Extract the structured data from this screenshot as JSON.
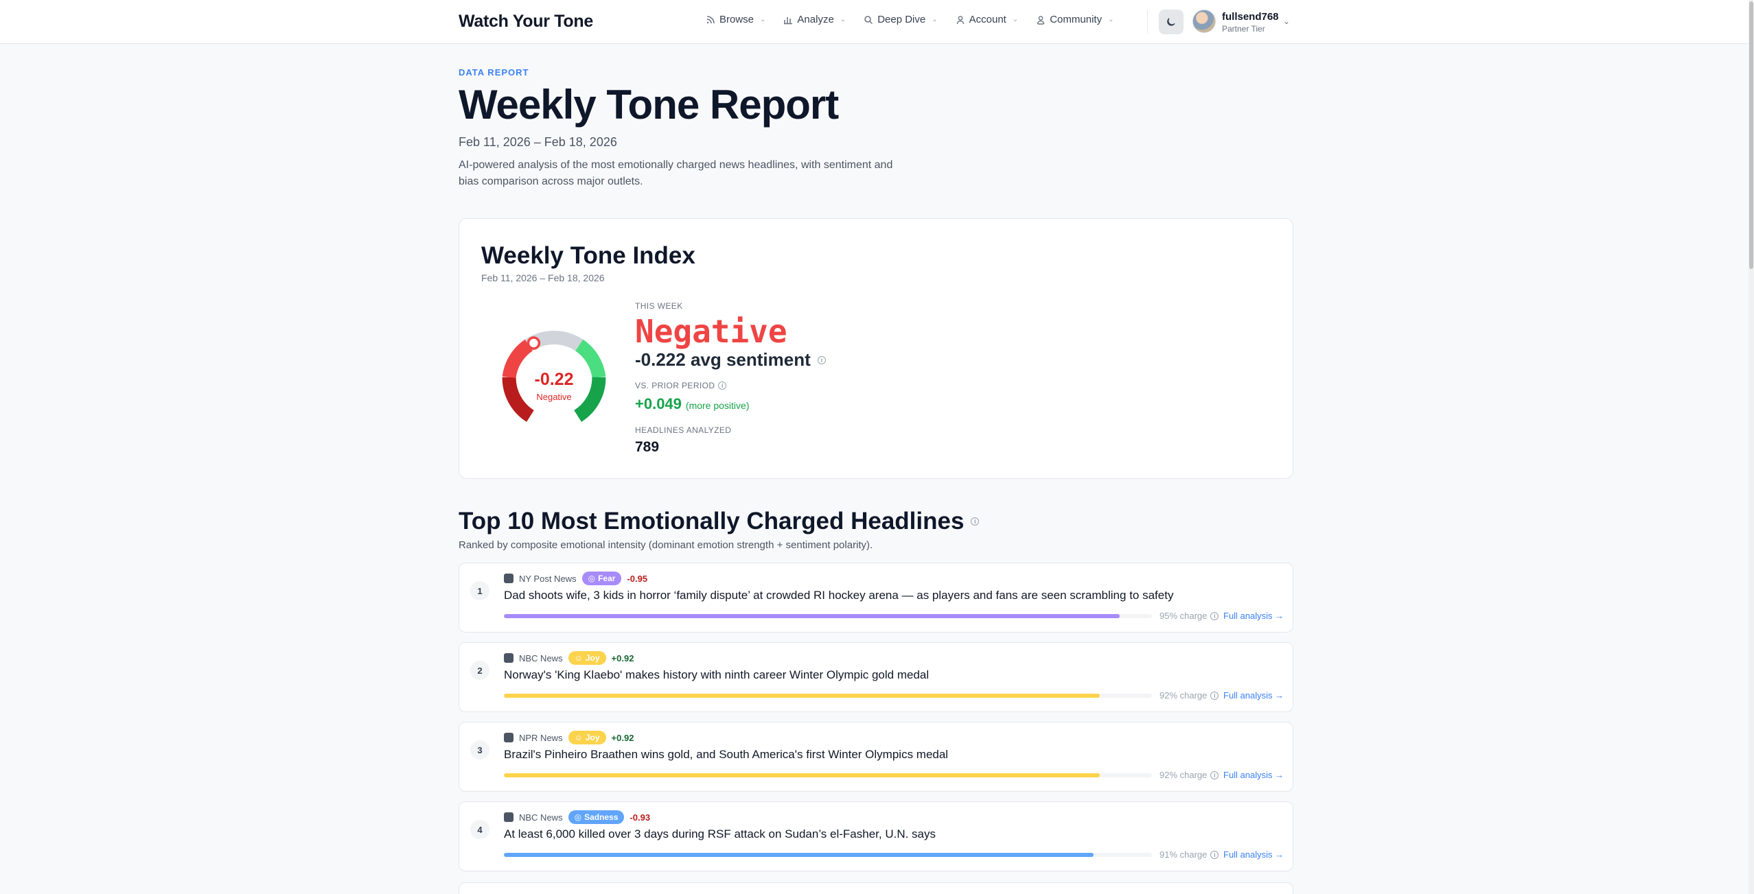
{
  "nav": {
    "brand": "Watch Your Tone",
    "menu": [
      {
        "label": "Browse",
        "icon": "rss-icon"
      },
      {
        "label": "Analyze",
        "icon": "bar-chart-icon"
      },
      {
        "label": "Deep Dive",
        "icon": "magnifier-icon"
      },
      {
        "label": "Account",
        "icon": "user-icon"
      },
      {
        "label": "Community",
        "icon": "users-icon"
      }
    ],
    "theme_icon": "moon-icon",
    "user": {
      "name": "fullsend768",
      "tier": "Partner Tier"
    }
  },
  "header": {
    "eyebrow": "DATA REPORT",
    "title": "Weekly Tone Report",
    "date_range": "Feb 11, 2026 – Feb 18, 2026",
    "intro": "AI-powered analysis of the most emotionally charged news headlines, with sentiment and bias comparison across major outlets."
  },
  "index": {
    "title": "Weekly Tone Index",
    "dates": "Feb 11, 2026 – Feb 18, 2026",
    "gauge": {
      "value_label": "-0.22",
      "state_label": "Negative",
      "value": -0.222,
      "min": -1,
      "max": 1
    },
    "this_week_label": "THIS WEEK",
    "tone_word": "Negative",
    "avg_sentiment": "-0.222 avg sentiment",
    "vs_label": "VS. PRIOR PERIOD",
    "delta": "+0.049",
    "delta_note": "(more positive)",
    "headlines_label": "HEADLINES ANALYZED",
    "headlines_count": "789"
  },
  "top10": {
    "title": "Top 10 Most Emotionally Charged Headlines",
    "subtitle": "Ranked by composite emotional intensity (dominant emotion strength + sentiment polarity).",
    "full_analysis_label": "Full analysis →",
    "items": [
      {
        "rank": "1",
        "source": "NY Post News",
        "emotion": "Fear",
        "score": "-0.95",
        "headline": "Dad shoots wife, 3 kids in horror ‘family dispute’ at crowded RI hockey arena — as players and fans are seen scrambling to safety",
        "charge": "95% charge",
        "pct": 0.95,
        "color": "#a78bfa",
        "score_color": "#b91c1c"
      },
      {
        "rank": "2",
        "source": "NBC News",
        "emotion": "Joy",
        "score": "+0.92",
        "headline": "Norway's 'King Klaebo' makes history with ninth career Winter Olympic gold medal",
        "charge": "92% charge",
        "pct": 0.92,
        "color": "#fcd34d",
        "score_color": "#166534"
      },
      {
        "rank": "3",
        "source": "NPR News",
        "emotion": "Joy",
        "score": "+0.92",
        "headline": "Brazil's Pinheiro Braathen wins gold, and South America's first Winter Olympics medal",
        "charge": "92% charge",
        "pct": 0.92,
        "color": "#fcd34d",
        "score_color": "#166534"
      },
      {
        "rank": "4",
        "source": "NBC News",
        "emotion": "Sadness",
        "score": "-0.93",
        "headline": "At least 6,000 killed over 3 days during RSF attack on Sudan’s el-Fasher, U.N. says",
        "charge": "91% charge",
        "pct": 0.91,
        "color": "#60a5fa",
        "score_color": "#b91c1c"
      }
    ]
  }
}
